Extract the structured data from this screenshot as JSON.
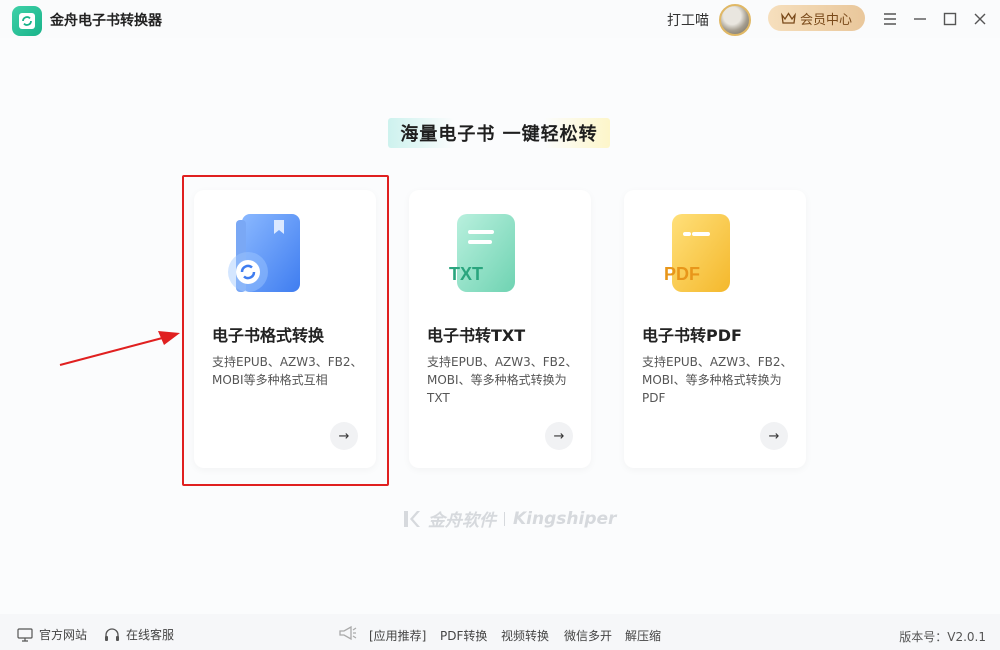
{
  "app": {
    "title": "金舟电子书转换器"
  },
  "header": {
    "username": "打工喵",
    "vip_label": "会员中心"
  },
  "slogan": "海量电子书  一键轻松转",
  "cards": [
    {
      "title": "电子书格式转换",
      "desc": "支持EPUB、AZW3、FB2、MOBI等多种格式互相",
      "icon": "ebook-convert-icon",
      "badge": ""
    },
    {
      "title": "电子书转TXT",
      "desc": "支持EPUB、AZW3、FB2、MOBI、等多种格式转换为TXT",
      "icon": "txt-file-icon",
      "badge": "TXT"
    },
    {
      "title": "电子书转PDF",
      "desc": "支持EPUB、AZW3、FB2、MOBI、等多种格式转换为PDF",
      "icon": "pdf-file-icon",
      "badge": "PDF"
    }
  ],
  "brand": {
    "cn": "金舟软件",
    "en": "Kingshiper"
  },
  "footer": {
    "official_site": "官方网站",
    "online_service": "在线客服",
    "recommend": "[应用推荐]",
    "links": [
      "PDF转换",
      "视频转换",
      "微信多开",
      "解压缩"
    ],
    "version": "版本号：V2.0.1"
  },
  "colors": {
    "accent_green": "#19b38a",
    "highlight_red": "#e02020",
    "vip_gold": "#e9c79b"
  }
}
